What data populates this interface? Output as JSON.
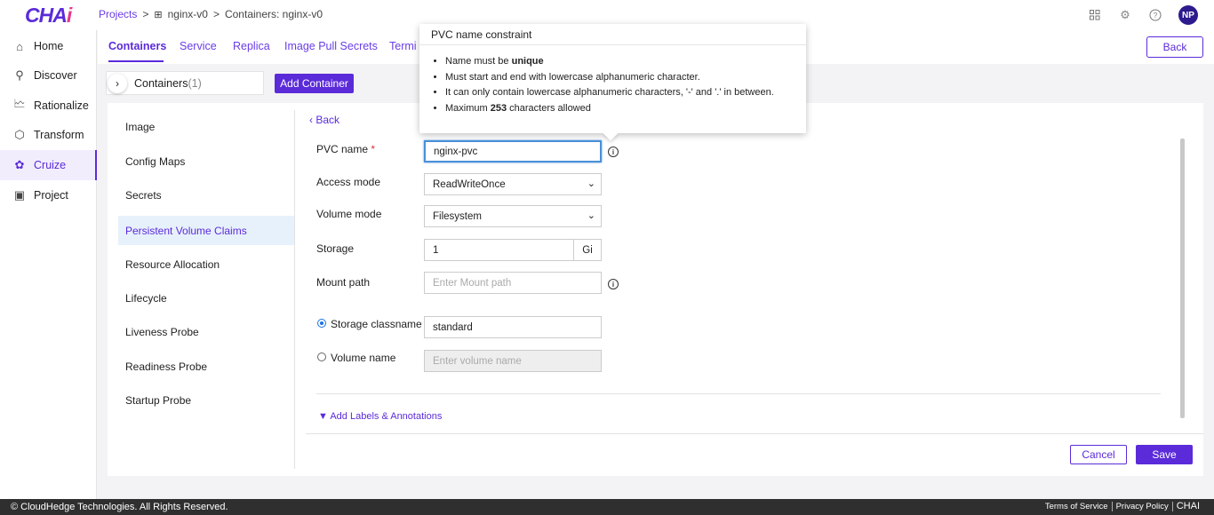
{
  "header": {
    "logo_main": "CHA",
    "logo_accent": "i",
    "breadcrumb": {
      "projects": "Projects",
      "project_icon": "grid-icon",
      "app": "nginx-v0",
      "current": "Containers: nginx-v0",
      "separator": ">"
    },
    "icons": [
      "apps-grid-icon",
      "gear-icon",
      "help-icon"
    ],
    "avatar_initials": "NP"
  },
  "sidebar": {
    "items": [
      {
        "label": "Home",
        "icon": "home-icon"
      },
      {
        "label": "Discover",
        "icon": "search-icon"
      },
      {
        "label": "Rationalize",
        "icon": "chart-icon"
      },
      {
        "label": "Transform",
        "icon": "cube-icon"
      },
      {
        "label": "Cruize",
        "icon": "cruize-icon"
      },
      {
        "label": "Project",
        "icon": "project-icon"
      }
    ],
    "active": "Cruize"
  },
  "tabs": {
    "items": [
      "Containers",
      "Service",
      "Replica",
      "Image Pull Secrets",
      "Termi"
    ],
    "active": "Containers",
    "back_label": "Back"
  },
  "containers": {
    "label": "Containers",
    "count": "(1)",
    "add_label": "Add Container"
  },
  "subnav": {
    "items": [
      "Image",
      "Config Maps",
      "Secrets",
      "Persistent Volume Claims",
      "Resource Allocation",
      "Lifecycle",
      "Liveness Probe",
      "Readiness Probe",
      "Startup Probe"
    ],
    "active": "Persistent Volume Claims"
  },
  "form": {
    "back_label": "Back",
    "pvc_name_label": "PVC name",
    "required_mark": "*",
    "pvc_name_value": "nginx-pvc",
    "access_mode_label": "Access mode",
    "access_mode_value": "ReadWriteOnce",
    "volume_mode_label": "Volume mode",
    "volume_mode_value": "Filesystem",
    "storage_label": "Storage",
    "storage_value": "1",
    "storage_unit": "Gi",
    "mount_path_label": "Mount path",
    "mount_path_placeholder": "Enter Mount path",
    "storage_classname_label": "Storage classname",
    "storage_classname_value": "standard",
    "storage_classname_selected": true,
    "volume_name_label": "Volume name",
    "volume_name_placeholder": "Enter volume name",
    "labels_link": "Add Labels & Annotations",
    "cancel_label": "Cancel",
    "save_label": "Save"
  },
  "tooltip": {
    "title": "PVC name constraint",
    "rule1_prefix": "Name must be ",
    "rule1_bold": "unique",
    "rule2": "Must start and end with lowercase alphanumeric character.",
    "rule3": "It can only contain lowercase alphanumeric characters, '-' and '.' in between.",
    "rule4_prefix": "Maximum ",
    "rule4_bold": "253",
    "rule4_suffix": " characters allowed"
  },
  "footer": {
    "copyright": "© CloudHedge Technologies. All Rights Reserved.",
    "terms": "Terms of Service",
    "privacy": "Privacy Policy",
    "brand": "CHAI"
  },
  "colors": {
    "primary": "#5b2bd9",
    "focus": "#4a90d9",
    "footer_bg": "#2f2f2f",
    "active_subnav_bg": "#e7f1fb"
  }
}
